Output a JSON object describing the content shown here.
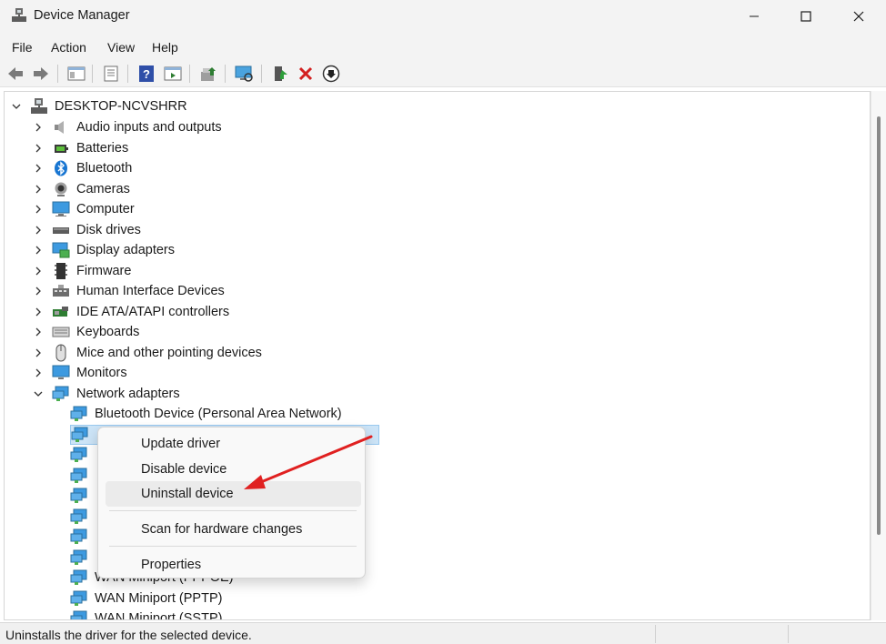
{
  "window": {
    "title": "Device Manager"
  },
  "menu": [
    "File",
    "Action",
    "View",
    "Help"
  ],
  "toolbar": {
    "icons": [
      "back-icon",
      "forward-icon",
      "show-hide-console-tree-icon",
      "properties-icon",
      "help-icon",
      "action-pane-icon",
      "update-driver-icon",
      "scan-hardware-icon",
      "enable-device-icon",
      "uninstall-device-icon",
      "disable-device-icon"
    ]
  },
  "tree": {
    "root": "DESKTOP-NCVSHRR",
    "categories": [
      {
        "label": "Audio inputs and outputs",
        "icon": "speaker-icon"
      },
      {
        "label": "Batteries",
        "icon": "battery-icon"
      },
      {
        "label": "Bluetooth",
        "icon": "bluetooth-icon"
      },
      {
        "label": "Cameras",
        "icon": "camera-icon"
      },
      {
        "label": "Computer",
        "icon": "computer-icon"
      },
      {
        "label": "Disk drives",
        "icon": "disk-drive-icon"
      },
      {
        "label": "Display adapters",
        "icon": "display-adapter-icon"
      },
      {
        "label": "Firmware",
        "icon": "firmware-icon"
      },
      {
        "label": "Human Interface Devices",
        "icon": "hid-icon"
      },
      {
        "label": "IDE ATA/ATAPI controllers",
        "icon": "ide-controller-icon"
      },
      {
        "label": "Keyboards",
        "icon": "keyboard-icon"
      },
      {
        "label": "Mice and other pointing devices",
        "icon": "mouse-icon"
      },
      {
        "label": "Monitors",
        "icon": "monitor-icon"
      },
      {
        "label": "Network adapters",
        "icon": "network-adapter-icon",
        "expanded": true
      }
    ],
    "network_children": [
      {
        "label": "Bluetooth Device (Personal Area Network)"
      },
      {
        "label": "",
        "selected": true
      },
      {
        "label": ""
      },
      {
        "label": ""
      },
      {
        "label": ""
      },
      {
        "label": ""
      },
      {
        "label": ""
      },
      {
        "label": ""
      },
      {
        "label": "WAN Miniport (PPPOE)"
      },
      {
        "label": "WAN Miniport (PPTP)"
      },
      {
        "label": "WAN Miniport (SSTP)"
      }
    ]
  },
  "context_menu": {
    "items": [
      "Update driver",
      "Disable device",
      "Uninstall device",
      "Scan for hardware changes",
      "Properties"
    ],
    "highlighted": "Uninstall device"
  },
  "statusbar": {
    "text": "Uninstalls the driver for the selected device."
  },
  "colors": {
    "accent_arrow": "#e02020",
    "selection": "#cce4f7"
  }
}
